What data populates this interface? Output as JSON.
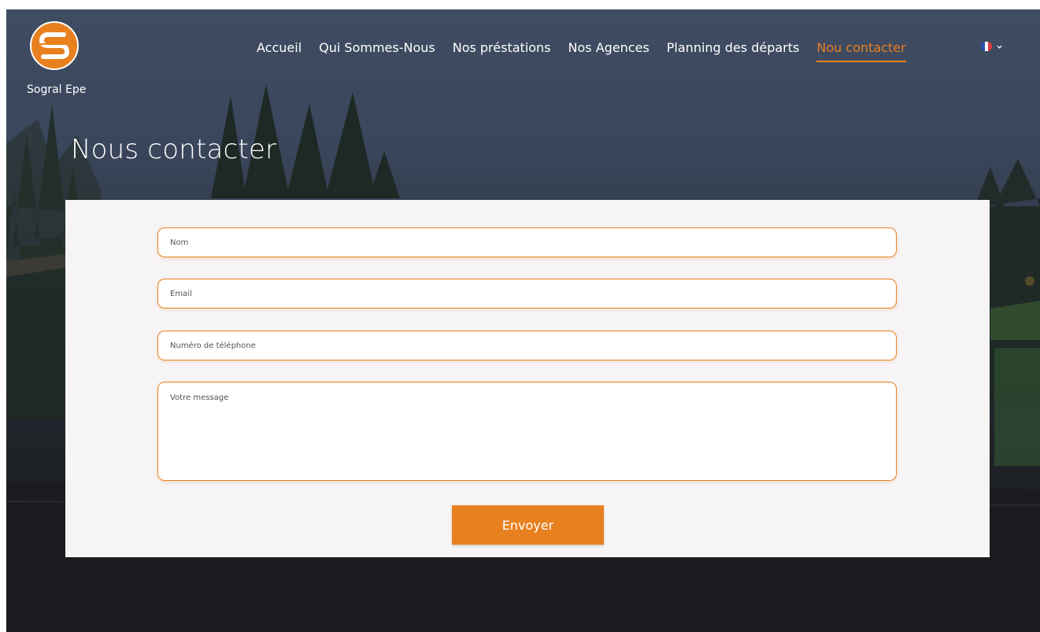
{
  "brand": {
    "name": "Sogral Epe",
    "logo_icon": "sogral-s-logo-icon"
  },
  "nav": {
    "items": [
      {
        "label": "Accueil",
        "active": false
      },
      {
        "label": "Qui Sommes-Nous",
        "active": false
      },
      {
        "label": "Nos préstations",
        "active": false
      },
      {
        "label": "Nos Agences",
        "active": false
      },
      {
        "label": "Planning des départs",
        "active": false
      },
      {
        "label": "Nou contacter",
        "active": true
      }
    ],
    "language": {
      "icon": "france-flag-icon",
      "dropdown_icon": "chevron-down-icon"
    }
  },
  "page": {
    "title": "Nous contacter"
  },
  "form": {
    "name_placeholder": "Nom",
    "email_placeholder": "Email",
    "phone_placeholder": "Numéro de téléphone",
    "message_placeholder": "Votre message",
    "submit_label": "Envoyer"
  },
  "colors": {
    "accent": "#e9801f",
    "card_background": "#f6f4f5",
    "nav_text": "#ffffff"
  }
}
